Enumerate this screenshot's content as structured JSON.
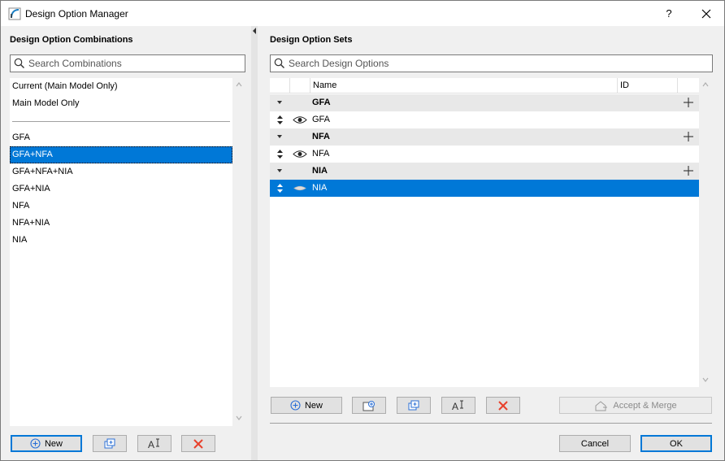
{
  "window": {
    "title": "Design Option Manager",
    "help_label": "?"
  },
  "left": {
    "heading": "Design Option Combinations",
    "search_placeholder": "Search Combinations",
    "combinations": [
      "Current (Main Model Only)",
      "Main Model Only",
      "GFA",
      "GFA+NFA",
      "GFA+NFA+NIA",
      "GFA+NIA",
      "NFA",
      "NFA+NIA",
      "NIA"
    ],
    "selected_combination": "GFA+NFA",
    "new_label": "New"
  },
  "right": {
    "heading": "Design Option Sets",
    "search_placeholder": "Search Design Options",
    "columns": [
      "Name",
      "ID"
    ],
    "sets": [
      {
        "name": "GFA",
        "options": [
          {
            "name": "GFA",
            "visible": true,
            "selected": false
          }
        ]
      },
      {
        "name": "NFA",
        "options": [
          {
            "name": "NFA",
            "visible": true,
            "selected": false
          }
        ]
      },
      {
        "name": "NIA",
        "options": [
          {
            "name": "NIA",
            "visible": false,
            "selected": true
          }
        ]
      }
    ],
    "new_label": "New",
    "accept_merge_label": "Accept & Merge",
    "cancel_label": "Cancel",
    "ok_label": "OK"
  },
  "colors": {
    "selection": "#0078d7",
    "delete_red": "#e8412c",
    "add_blue": "#2a6fd6"
  }
}
